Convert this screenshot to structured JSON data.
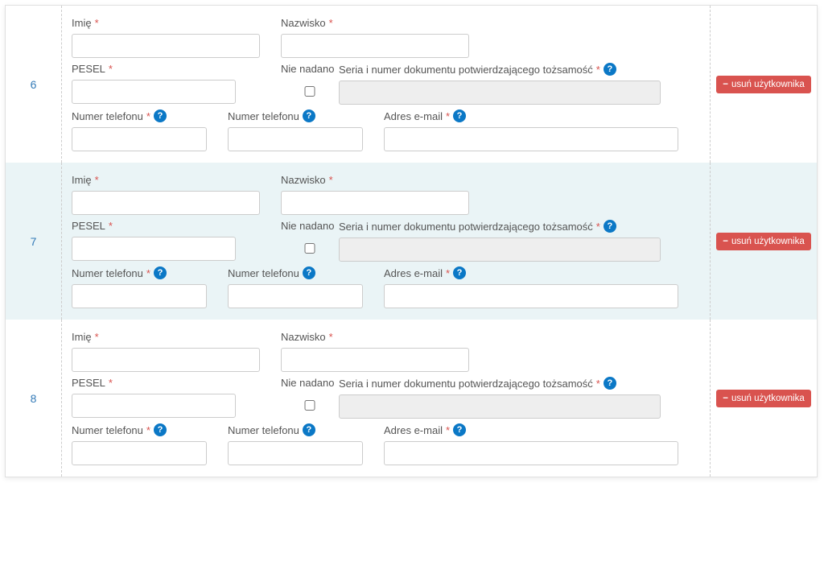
{
  "labels": {
    "imie": "Imię",
    "nazwisko": "Nazwisko",
    "pesel": "PESEL",
    "nie_nadano": "Nie nadano",
    "dokument": "Seria i numer dokumentu potwierdzającego tożsamość",
    "telefon": "Numer telefonu",
    "email": "Adres e-mail",
    "required_mark": "*",
    "help_symbol": "?"
  },
  "delete_label": "usuń użytkownika",
  "rows": [
    {
      "number": "6",
      "alt": false
    },
    {
      "number": "7",
      "alt": true
    },
    {
      "number": "8",
      "alt": false
    }
  ]
}
